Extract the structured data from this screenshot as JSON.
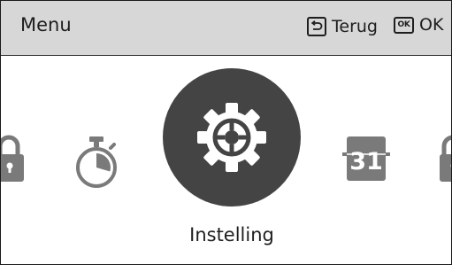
{
  "header": {
    "title": "Menu",
    "back_label": "Terug",
    "ok_key": "OK",
    "ok_label": "OK"
  },
  "carousel": {
    "items": [
      {
        "icon": "padlock-icon"
      },
      {
        "icon": "stopwatch-icon"
      },
      {
        "icon": "gear-icon",
        "selected": true,
        "label": "Instelling"
      },
      {
        "icon": "calendar-icon",
        "text": "31"
      },
      {
        "icon": "padlock-icon"
      }
    ]
  },
  "colors": {
    "header_bg": "#d7d7d7",
    "icon_gray": "#7a7a7a",
    "selected_bg": "#444444"
  }
}
